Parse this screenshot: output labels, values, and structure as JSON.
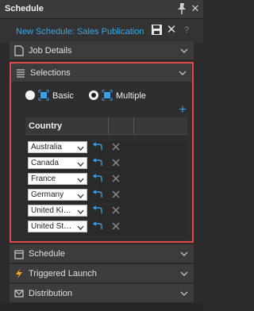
{
  "window": {
    "title": "Schedule"
  },
  "header": {
    "schedule_name": "New Schedule: Sales Publication",
    "help_label": "?"
  },
  "sections": {
    "job_details": "Job Details",
    "selections": "Selections",
    "schedule": "Schedule",
    "triggered_launch": "Triggered Launch",
    "distribution": "Distribution"
  },
  "selections": {
    "mode": "Multiple",
    "basic_label": "Basic",
    "multiple_label": "Multiple",
    "add_label": "+",
    "column_header": "Country",
    "rows": [
      {
        "value": "Australia"
      },
      {
        "value": "Canada"
      },
      {
        "value": "France"
      },
      {
        "value": "Germany"
      },
      {
        "value": "United Kingdom"
      },
      {
        "value": "United States"
      }
    ]
  },
  "colors": {
    "accent": "#38a8e8",
    "highlight_border": "#e04a4a",
    "trigger_icon": "#f5a623"
  }
}
